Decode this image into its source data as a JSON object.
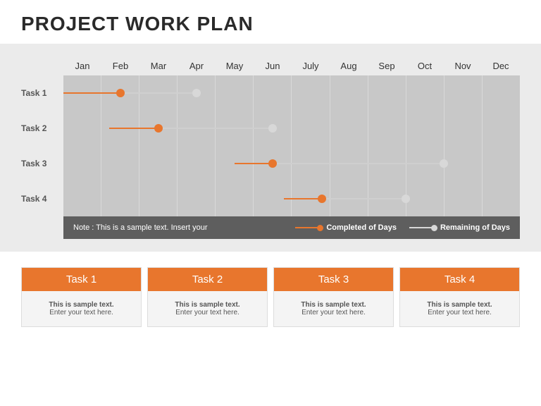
{
  "title": "PROJECT WORK PLAN",
  "chart_data": {
    "type": "gantt",
    "categories": [
      "Jan",
      "Feb",
      "Mar",
      "Apr",
      "May",
      "Jun",
      "July",
      "Aug",
      "Sep",
      "Oct",
      "Nov",
      "Dec"
    ],
    "series": [
      {
        "name": "Task 1",
        "start": 0,
        "completed_end": 1.5,
        "remaining_end": 3.5
      },
      {
        "name": "Task 2",
        "start": 1.2,
        "completed_end": 2.5,
        "remaining_end": 5.5
      },
      {
        "name": "Task 3",
        "start": 4.5,
        "completed_end": 5.5,
        "remaining_end": 10.0
      },
      {
        "name": "Task 4",
        "start": 5.8,
        "completed_end": 6.8,
        "remaining_end": 9.0
      }
    ],
    "legend": {
      "note": "Note : This is a sample text. Insert your",
      "completed": "Completed of Days",
      "remaining": "Remaining of Days"
    }
  },
  "cards": [
    {
      "title": "Task 1",
      "line1": "This is sample text.",
      "line2": "Enter your text here."
    },
    {
      "title": "Task 2",
      "line1": "This is sample text.",
      "line2": "Enter your text here."
    },
    {
      "title": "Task 3",
      "line1": "This is sample text.",
      "line2": "Enter your text here."
    },
    {
      "title": "Task 4",
      "line1": "This is sample text.",
      "line2": "Enter your text here."
    }
  ],
  "colors": {
    "accent": "#e8762d",
    "remaining": "#d8d8d8"
  }
}
